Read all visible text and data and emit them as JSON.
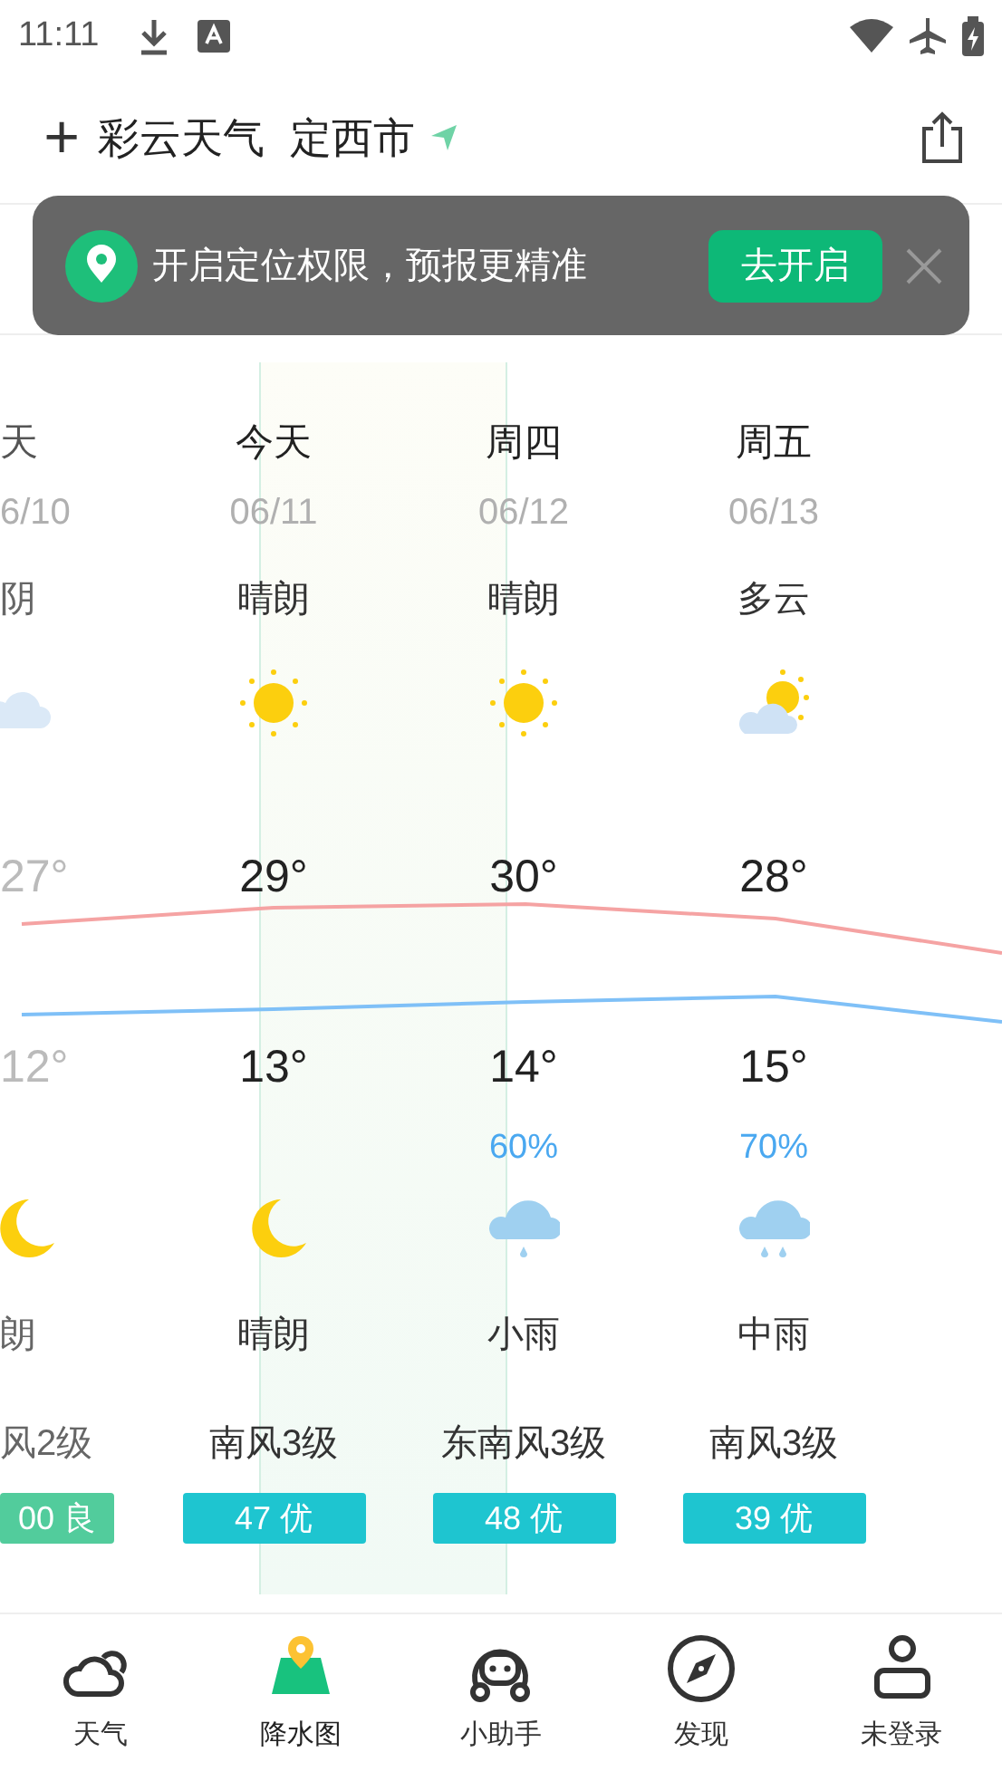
{
  "status_bar": {
    "time": "11:11"
  },
  "header": {
    "add_symbol": "+",
    "app_name": "彩云天气",
    "city": "定西市"
  },
  "toast": {
    "message": "开启定位权限，预报更精准",
    "action": "去开启"
  },
  "days": [
    {
      "day": "天",
      "date": "6/10",
      "daytime": {
        "condition": "阴",
        "kind": "cloudy"
      },
      "high": "27°",
      "low": "12°",
      "night": {
        "condition": "朗",
        "kind": "moon"
      },
      "wind": "风2级",
      "aqi": {
        "text": "00 良",
        "color": "#52cc9c"
      },
      "past": true,
      "selected": false
    },
    {
      "day": "今天",
      "date": "06/11",
      "daytime": {
        "condition": "晴朗",
        "kind": "sunny"
      },
      "high": "29°",
      "low": "13°",
      "night": {
        "condition": "晴朗",
        "kind": "moon"
      },
      "wind": "南风3级",
      "aqi": {
        "text": "47 优",
        "color": "#1ec5d0"
      },
      "past": false,
      "selected": true
    },
    {
      "day": "周四",
      "date": "06/12",
      "daytime": {
        "condition": "晴朗",
        "kind": "sunny"
      },
      "high": "30°",
      "low": "14°",
      "rain_chance": "60%",
      "night": {
        "condition": "小雨",
        "kind": "rain_light"
      },
      "wind": "东南风3级",
      "aqi": {
        "text": "48 优",
        "color": "#1ec5d0"
      },
      "past": false,
      "selected": false
    },
    {
      "day": "周五",
      "date": "06/13",
      "daytime": {
        "condition": "多云",
        "kind": "partly_cloudy"
      },
      "high": "28°",
      "low": "15°",
      "rain_chance": "70%",
      "night": {
        "condition": "中雨",
        "kind": "rain_medium"
      },
      "wind": "南风3级",
      "aqi": {
        "text": "39 优",
        "color": "#1ec5d0"
      },
      "past": false,
      "selected": false
    }
  ],
  "bottom_nav": [
    {
      "label": "天气",
      "kind": "cloud",
      "selected": false
    },
    {
      "label": "降水图",
      "kind": "map",
      "selected": true
    },
    {
      "label": "小助手",
      "kind": "robot",
      "selected": false
    },
    {
      "label": "发现",
      "kind": "compass",
      "selected": false
    },
    {
      "label": "未登录",
      "kind": "person",
      "selected": false
    }
  ]
}
